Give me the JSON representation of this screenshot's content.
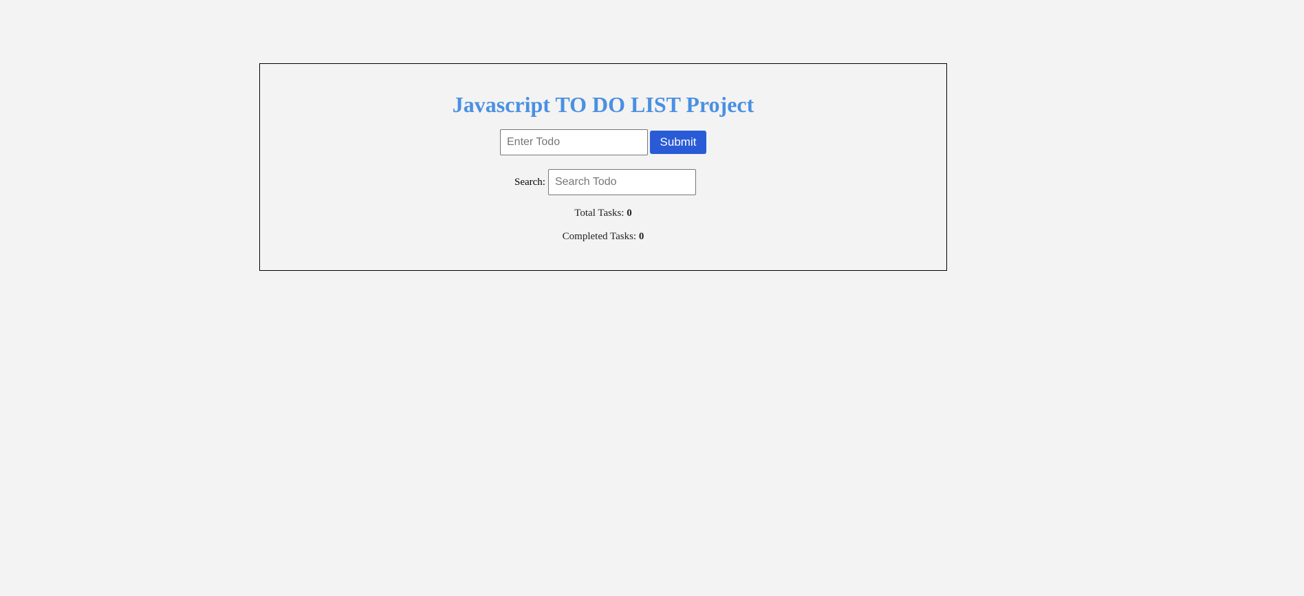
{
  "header": {
    "title": "Javascript TO DO LIST Project"
  },
  "add_form": {
    "input_placeholder": "Enter Todo",
    "input_value": "",
    "submit_label": "Submit"
  },
  "search": {
    "label": "Search:",
    "placeholder": "Search Todo",
    "value": ""
  },
  "stats": {
    "total_label": "Total Tasks: ",
    "total_value": "0",
    "completed_label": "Completed Tasks: ",
    "completed_value": "0"
  },
  "colors": {
    "title": "#4a90e2",
    "submit_button": "#2a5bd7",
    "background": "#f3f3f3"
  }
}
